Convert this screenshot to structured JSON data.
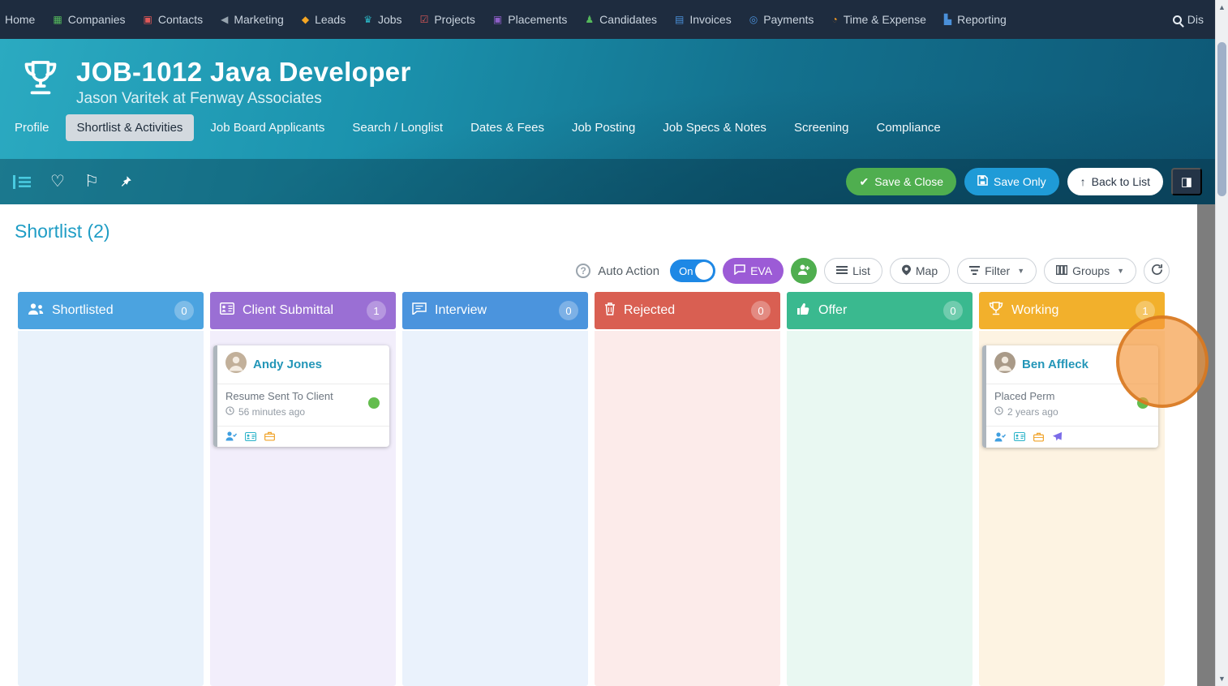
{
  "icons": {
    "companies": "▦",
    "contacts": "▣",
    "marketing": "◀",
    "leads": "◆",
    "jobs": "♛",
    "projects": "☑",
    "placements": "▣",
    "candidates": "♟",
    "invoices": "▤",
    "payments": "◎",
    "time_expense": "◔",
    "reporting": "▙",
    "heart": "♡",
    "flag": "⚐",
    "panel": "◨"
  },
  "nav": {
    "items": [
      {
        "label": "Home",
        "icon": "home-icon"
      },
      {
        "label": "Companies",
        "icon": "companies-icon",
        "color": "#55b95c"
      },
      {
        "label": "Contacts",
        "icon": "contacts-icon",
        "color": "#e05858"
      },
      {
        "label": "Marketing",
        "icon": "marketing-icon",
        "color": "#96a3ae"
      },
      {
        "label": "Leads",
        "icon": "leads-icon",
        "color": "#f5a623"
      },
      {
        "label": "Jobs",
        "icon": "jobs-trophy-icon",
        "color": "#2bb5c4"
      },
      {
        "label": "Projects",
        "icon": "projects-icon",
        "color": "#e05858"
      },
      {
        "label": "Placements",
        "icon": "placements-icon",
        "color": "#8e5fc8"
      },
      {
        "label": "Candidates",
        "icon": "candidates-icon",
        "color": "#55b95c"
      },
      {
        "label": "Invoices",
        "icon": "invoices-icon",
        "color": "#4a90d9"
      },
      {
        "label": "Payments",
        "icon": "payments-icon",
        "color": "#4a90d9"
      },
      {
        "label": "Time & Expense",
        "icon": "time-expense-icon",
        "color": "#f59a23"
      },
      {
        "label": "Reporting",
        "icon": "reporting-icon",
        "color": "#4a90d9"
      },
      {
        "label": "Dis",
        "icon": "search-icon",
        "color": "#ffffff"
      }
    ]
  },
  "header": {
    "title": "JOB-1012 Java Developer",
    "subtitle": "Jason Varitek at Fenway Associates"
  },
  "tabs": [
    {
      "label": "Profile",
      "active": false
    },
    {
      "label": "Shortlist & Activities",
      "active": true
    },
    {
      "label": "Job Board Applicants",
      "active": false
    },
    {
      "label": "Search / Longlist",
      "active": false
    },
    {
      "label": "Dates & Fees",
      "active": false
    },
    {
      "label": "Job Posting",
      "active": false
    },
    {
      "label": "Job Specs & Notes",
      "active": false
    },
    {
      "label": "Screening",
      "active": false
    },
    {
      "label": "Compliance",
      "active": false
    }
  ],
  "action_bar": {
    "save_close_label": "Save & Close",
    "save_only_label": "Save Only",
    "back_to_list_label": "Back to List"
  },
  "board": {
    "heading": "Shortlist (2)",
    "auto_action_label": "Auto Action",
    "auto_action_state": "On",
    "eva_label": "EVA",
    "view_buttons": {
      "list": "List",
      "map": "Map",
      "filter": "Filter",
      "groups": "Groups"
    },
    "columns": [
      {
        "name": "Shortlisted",
        "count": "0",
        "icon": "people-icon",
        "header_color": "#4ba3e0",
        "body_color": "#e9f2fb",
        "cards": []
      },
      {
        "name": "Client Submittal",
        "count": "1",
        "icon": "submittal-card-icon",
        "header_color": "#9a6fd4",
        "body_color": "#f2eefb",
        "cards": [
          {
            "name": "Andy Jones",
            "status": "Resume Sent To Client",
            "time": "56 minutes ago",
            "icons": [
              "candidate-check-icon",
              "id-card-icon",
              "briefcase-icon"
            ]
          }
        ]
      },
      {
        "name": "Interview",
        "count": "0",
        "icon": "chat-icon",
        "header_color": "#4b94dd",
        "body_color": "#eaf2fc",
        "cards": []
      },
      {
        "name": "Rejected",
        "count": "0",
        "icon": "trash-icon",
        "header_color": "#d95f52",
        "body_color": "#fcebea",
        "cards": []
      },
      {
        "name": "Offer",
        "count": "0",
        "icon": "thumbs-up-icon",
        "header_color": "#3ab98f",
        "body_color": "#e9f8f2",
        "cards": []
      },
      {
        "name": "Working",
        "count": "1",
        "icon": "trophy-icon",
        "header_color": "#f2b02c",
        "body_color": "#fdf3e2",
        "cards": [
          {
            "name": "Ben Affleck",
            "status": "Placed Perm",
            "time": "2 years ago",
            "icons": [
              "candidate-check-icon",
              "id-card-icon",
              "briefcase-icon",
              "send-icon"
            ]
          }
        ]
      }
    ]
  }
}
